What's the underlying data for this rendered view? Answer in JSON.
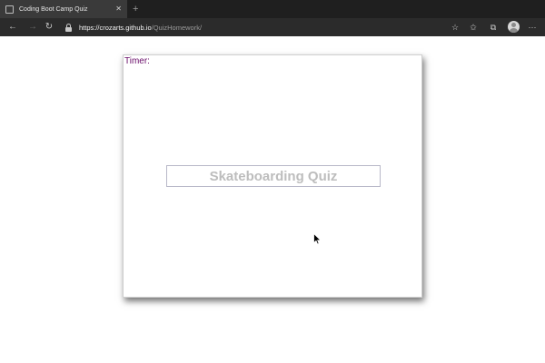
{
  "browser": {
    "tab": {
      "title": "Coding Boot Camp Quiz",
      "close_glyph": "✕",
      "favicon": "page-icon"
    },
    "new_tab_glyph": "+",
    "address": {
      "host": "https://crozarts.github.io",
      "path": "/QuizHomework/"
    },
    "nav": {
      "back_glyph": "←",
      "forward_glyph": "→",
      "reload_glyph": "↻"
    },
    "toolbar_icons": {
      "favorite": "☆",
      "favorites": "✩",
      "collections": "⧉",
      "more": "···"
    },
    "colors": {
      "tabstrip": "#1f1f1f",
      "toolbar": "#2b2b2b",
      "active_tab": "#3a3a3a"
    }
  },
  "quiz": {
    "timer_label": "Timer:",
    "title": "Skateboarding Quiz",
    "colors": {
      "timer": "#6a0d6a",
      "title": "#bdbdbd"
    }
  }
}
